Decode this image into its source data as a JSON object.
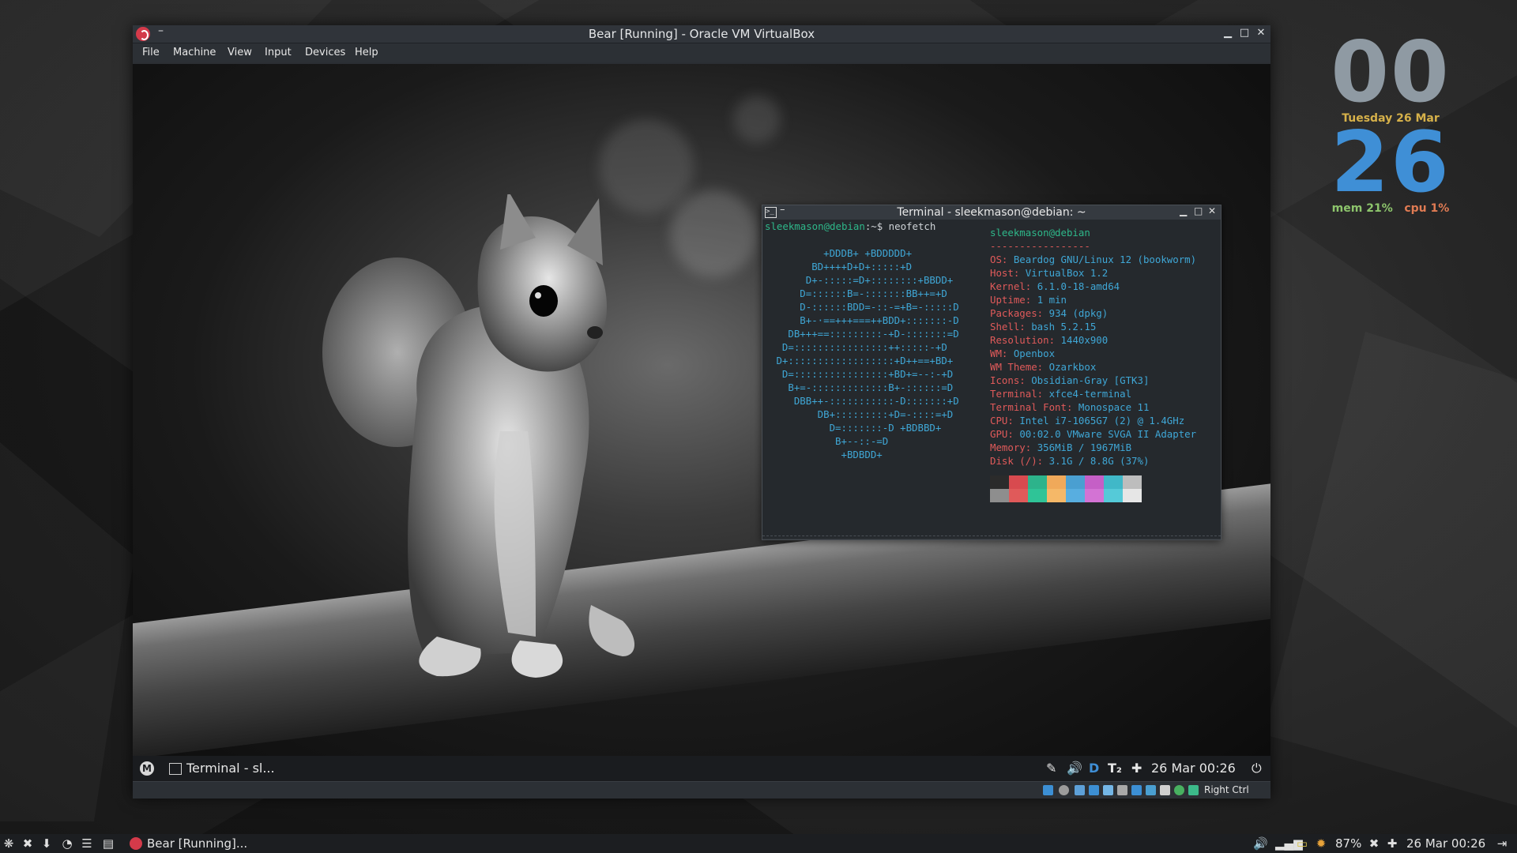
{
  "vbox": {
    "title": "Bear [Running] - Oracle VM VirtualBox",
    "menu": [
      "File",
      "Machine",
      "View",
      "Input",
      "Devices",
      "Help"
    ],
    "status_right": "Right Ctrl"
  },
  "terminal": {
    "title": "Terminal - sleekmason@debian: ~",
    "prompt_user": "sleekmason@debian",
    "prompt_suffix": ":~$ neofetch",
    "user_host": "sleekmason@debian",
    "separator": "-----------------",
    "ascii_art": [
      "         +DDDB+ +BDDDDD+",
      "       BD++++D+D+:::::+D",
      "      D+-:::::=D+::::::::+BBDD+",
      "     D=::::::B=-:::::::BB++=+D",
      "     D-::::::BDD=-::-=+B=-:::::D",
      "     B+-·==+++===++BDD+:::::::-D",
      "   DB+++==:::::::::-+D-:::::::=D",
      "  D=::::::::::::::::++:::::-+D",
      " D+::::::::::::::::::+D++==+BD+",
      "  D=::::::::::::::::+BD+=--:-+D",
      "   B+=-:::::::::::::B+-::::::=D",
      "    DBB++-:::::::::::-D:::::::+D",
      "        DB+:::::::::+D=-::::=+D",
      "          D=:::::::-D +BDBBD+",
      "           B+--::-=D",
      "            +BDBDD+"
    ],
    "info": [
      {
        "key": "OS",
        "value": "Beardog GNU/Linux 12 (bookworm)"
      },
      {
        "key": "Host",
        "value": "VirtualBox 1.2"
      },
      {
        "key": "Kernel",
        "value": "6.1.0-18-amd64"
      },
      {
        "key": "Uptime",
        "value": "1 min"
      },
      {
        "key": "Packages",
        "value": "934 (dpkg)"
      },
      {
        "key": "Shell",
        "value": "bash 5.2.15"
      },
      {
        "key": "Resolution",
        "value": "1440x900"
      },
      {
        "key": "WM",
        "value": "Openbox"
      },
      {
        "key": "WM Theme",
        "value": "Ozarkbox"
      },
      {
        "key": "Icons",
        "value": "Obsidian-Gray [GTK3]"
      },
      {
        "key": "Terminal",
        "value": "xfce4-terminal"
      },
      {
        "key": "Terminal Font",
        "value": "Monospace 11"
      },
      {
        "key": "CPU",
        "value": "Intel i7-1065G7 (2) @ 1.4GHz"
      },
      {
        "key": "GPU",
        "value": "00:02.0 VMware SVGA II Adapter"
      },
      {
        "key": "Memory",
        "value": "356MiB / 1967MiB"
      },
      {
        "key": "Disk (/)",
        "value": "3.1G / 8.8G (37%)"
      }
    ],
    "palette_top": [
      "#2b2b2b",
      "#d84a4f",
      "#2db38b",
      "#f0a95a",
      "#4a9fd1",
      "#c55fc6",
      "#40b8c8",
      "#bdbdbd"
    ],
    "palette_bottom": [
      "#8e8e8e",
      "#e05a5a",
      "#2fc497",
      "#f5b868",
      "#58aee0",
      "#d373d4",
      "#55cad8",
      "#e6e6e6"
    ]
  },
  "guest_panel": {
    "task_label": "Terminal - sl...",
    "clock": "26 Mar 00:26"
  },
  "conky": {
    "hour": "00",
    "date": "Tuesday 26 Mar",
    "minute": "26",
    "mem_label": "mem",
    "mem_value": "21%",
    "cpu_label": "cpu",
    "cpu_value": "1%"
  },
  "host_panel": {
    "task_label": "Bear [Running]...",
    "battery": "87%",
    "clock": "26 Mar 00:26"
  }
}
